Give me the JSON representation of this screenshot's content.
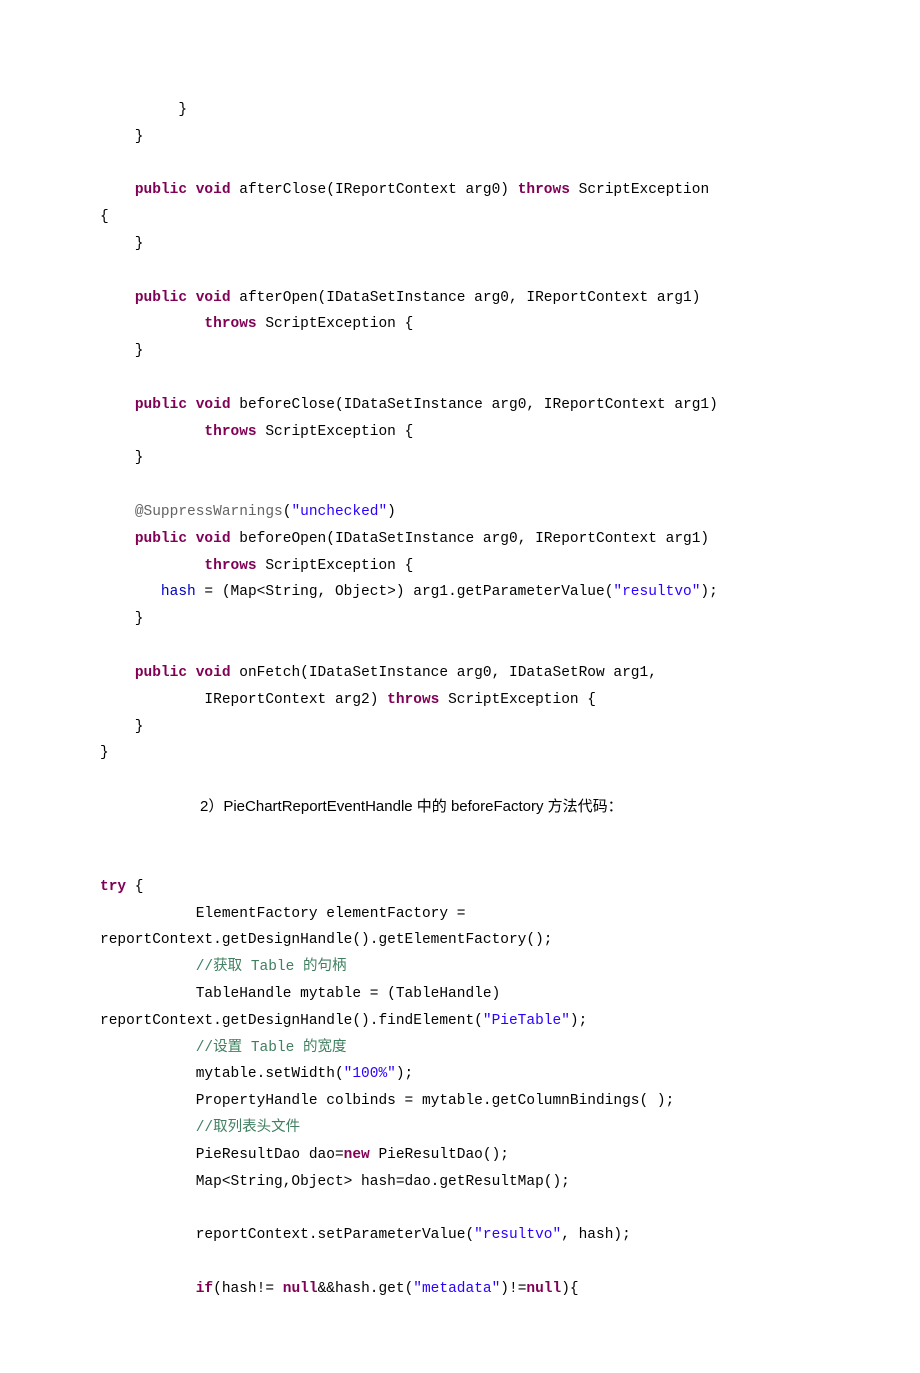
{
  "block1": {
    "l1": "         }",
    "l2": "    }",
    "l3": "",
    "l4a": "    ",
    "l4b": "public",
    "l4c": " ",
    "l4d": "void",
    "l4e": " afterClose(IReportContext arg0) ",
    "l4f": "throws",
    "l4g": " ScriptException ",
    "l5": "{",
    "l6": "    }",
    "l7": "",
    "l8a": "    ",
    "l8b": "public",
    "l8c": " ",
    "l8d": "void",
    "l8e": " afterOpen(IDataSetInstance arg0, IReportContext arg1)",
    "l9a": "            ",
    "l9b": "throws",
    "l9c": " ScriptException {",
    "l10": "    }",
    "l11": "",
    "l12a": "    ",
    "l12b": "public",
    "l12c": " ",
    "l12d": "void",
    "l12e": " beforeClose(IDataSetInstance arg0, IReportContext arg1)",
    "l13a": "            ",
    "l13b": "throws",
    "l13c": " ScriptException {",
    "l14": "    }",
    "l15": "",
    "l16a": "    ",
    "l16b": "@SuppressWarnings",
    "l16c": "(",
    "l16d": "\"unchecked\"",
    "l16e": ")",
    "l17a": "    ",
    "l17b": "public",
    "l17c": " ",
    "l17d": "void",
    "l17e": " beforeOpen(IDataSetInstance arg0, IReportContext arg1)",
    "l18a": "            ",
    "l18b": "throws",
    "l18c": " ScriptException {",
    "l19a": "       ",
    "l19b": "hash",
    "l19c": " = (Map<String, Object>) arg1.getParameterValue(",
    "l19d": "\"resultvo\"",
    "l19e": ");",
    "l20": "    }",
    "l21": "",
    "l22a": "    ",
    "l22b": "public",
    "l22c": " ",
    "l22d": "void",
    "l22e": " onFetch(IDataSetInstance arg0, IDataSetRow arg1,",
    "l23a": "            IReportContext arg2) ",
    "l23b": "throws",
    "l23c": " ScriptException {",
    "l24": "    }",
    "l25": "}"
  },
  "prose": "2）PieChartReportEventHandle 中的  beforeFactory  方法代码：",
  "block2": {
    "l1a": "try",
    "l1b": " {",
    "l2": "           ElementFactory elementFactory = ",
    "l3": "reportContext.getDesignHandle().getElementFactory();",
    "l4a": "           ",
    "l4b": "//获取 ",
    "l4c": "Table ",
    "l4d": "的句柄",
    "l5": "           TableHandle mytable = (TableHandle) ",
    "l6a": "reportContext.getDesignHandle().findElement(",
    "l6b": "\"PieTable\"",
    "l6c": ");",
    "l7a": "           ",
    "l7b": "//设置 ",
    "l7c": "Table ",
    "l7d": "的宽度",
    "l8a": "           mytable.setWidth(",
    "l8b": "\"100%\"",
    "l8c": ");",
    "l9": "           PropertyHandle colbinds = mytable.getColumnBindings( );",
    "l10a": "           ",
    "l10b": "//取列表头文件",
    "l11a": "           PieResultDao dao=",
    "l11b": "new",
    "l11c": " PieResultDao();",
    "l12": "           Map<String,Object> hash=dao.getResultMap();",
    "l13": "           ",
    "l14a": "           reportContext.setParameterValue(",
    "l14b": "\"resultvo\"",
    "l14c": ", hash);",
    "l15": "           ",
    "l16a": "           ",
    "l16b": "if",
    "l16c": "(hash!= ",
    "l16d": "null",
    "l16e": "&&hash.get(",
    "l16f": "\"metadata\"",
    "l16g": ")!=",
    "l16h": "null",
    "l16i": "){"
  }
}
